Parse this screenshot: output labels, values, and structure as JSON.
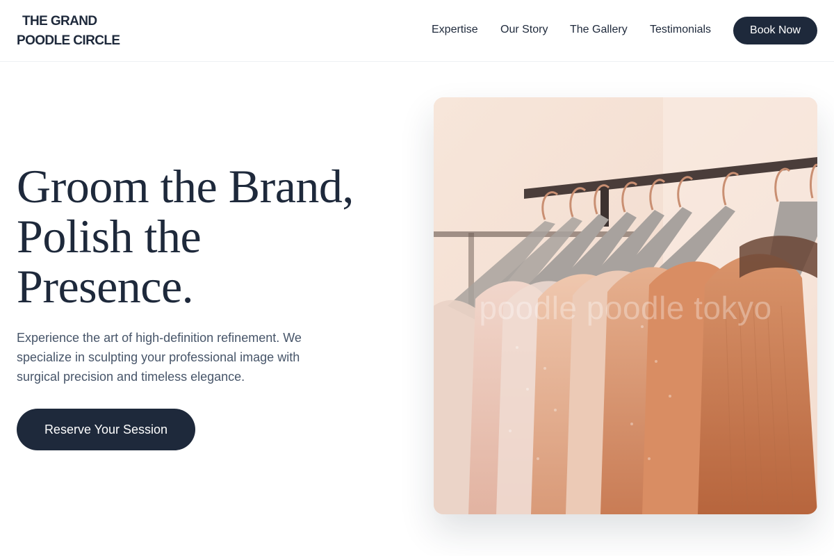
{
  "header": {
    "logo_line1": "THE GRAND",
    "logo_line2": "POODLE CIRCLE",
    "nav": [
      "Expertise",
      "Our Story",
      "The Gallery",
      "Testimonials"
    ],
    "book_label": "Book Now"
  },
  "hero": {
    "title_lines": [
      "Groom the Brand,",
      "Polish the",
      "Presence."
    ],
    "subtitle": "Experience the art of high-definition refinement. We specialize in sculpting your professional image with surgical precision and timeless elegance.",
    "cta_label": "Reserve Your Session"
  },
  "photo": {
    "watermark": "poodle poodle tokyo"
  },
  "colors": {
    "primary": "#1e293b",
    "body_text": "#475569",
    "background": "#ffffff"
  }
}
